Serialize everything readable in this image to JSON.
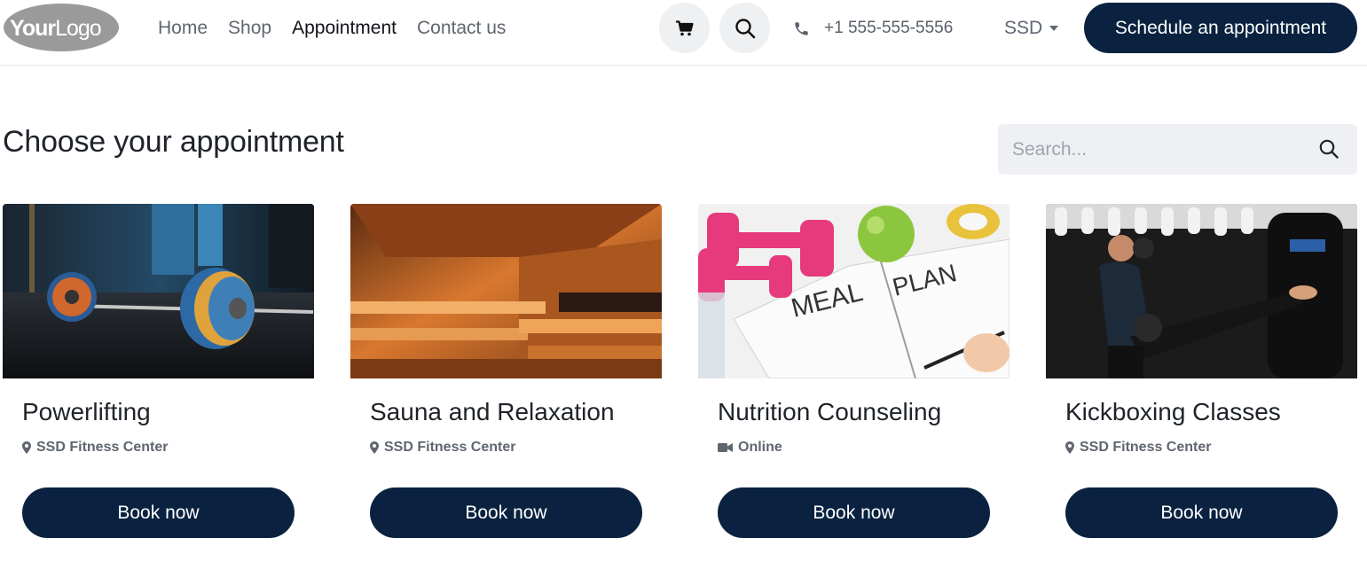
{
  "header": {
    "logo_text": "YourLogo",
    "nav": [
      {
        "label": "Home"
      },
      {
        "label": "Shop"
      },
      {
        "label": "Appointment"
      },
      {
        "label": "Contact us"
      }
    ],
    "phone": "+1 555-555-5556",
    "currency": "SSD",
    "cta_label": "Schedule an appointment",
    "icons": {
      "cart": "cart-icon",
      "search": "search-icon",
      "phone": "phone-icon",
      "caret": "chevron-down-icon"
    }
  },
  "page": {
    "title": "Choose your appointment",
    "search_placeholder": "Search..."
  },
  "cards": [
    {
      "name": "Powerlifting",
      "location": "SSD Fitness Center",
      "location_icon": "map-marker-icon",
      "button": "Book now"
    },
    {
      "name": "Sauna and Relaxation",
      "location": "SSD Fitness Center",
      "location_icon": "map-marker-icon",
      "button": "Book now"
    },
    {
      "name": "Nutrition Counseling",
      "location": "Online",
      "location_icon": "video-camera-icon",
      "button": "Book now"
    },
    {
      "name": "Kickboxing Classes",
      "location": "SSD Fitness Center",
      "location_icon": "map-marker-icon",
      "button": "Book now"
    }
  ],
  "colors": {
    "primary": "#0a2240",
    "muted_text": "#5f6670",
    "search_bg": "#eef0f3"
  }
}
